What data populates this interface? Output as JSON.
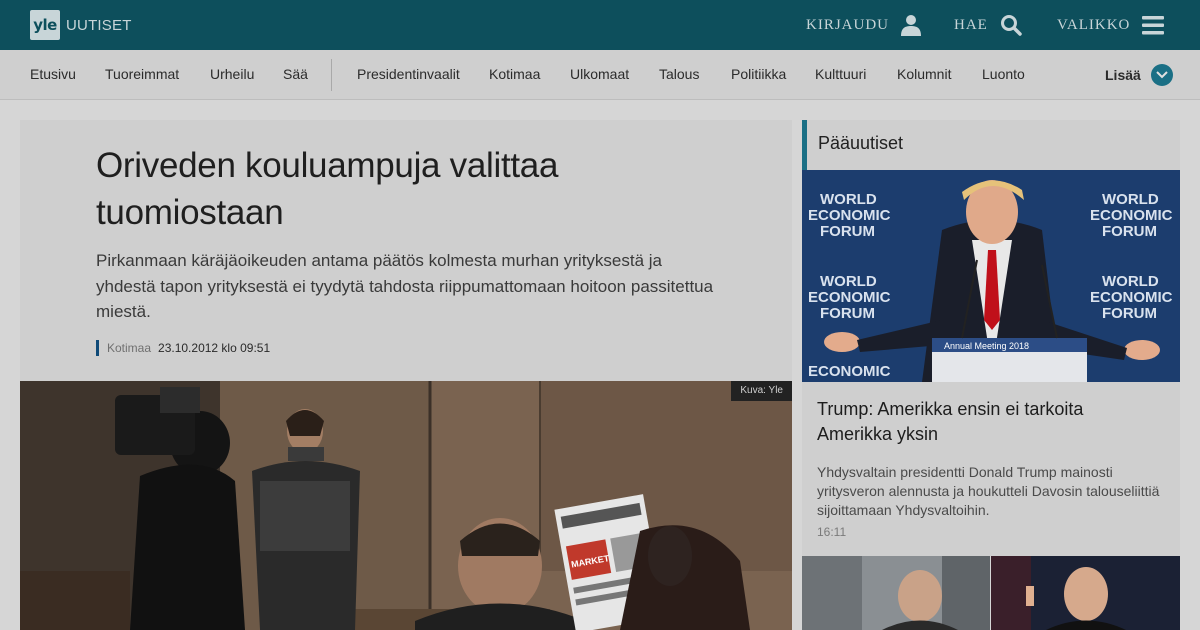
{
  "header": {
    "logo_mark": "yle",
    "logo_text": "UUTISET",
    "login_label": "KIRJAUDU",
    "search_label": "HAE",
    "menu_label": "VALIKKO",
    "icons": {
      "login": "user-icon",
      "search": "search-icon",
      "menu": "hamburger-menu-icon"
    }
  },
  "nav": {
    "items": [
      "Etusivu",
      "Tuoreimmat",
      "Urheilu",
      "Sää",
      "Presidentinvaalit",
      "Kotimaa",
      "Ulkomaat",
      "Talous",
      "Politiikka",
      "Kulttuuri",
      "Kolumnit",
      "Luonto"
    ],
    "more_label": "Lisää"
  },
  "article": {
    "title": "Oriveden kouluampuja valittaa tuomiostaan",
    "lead": "Pirkanmaan käräjäoikeuden antama päätös kolmesta murhan yrityksestä ja yhdestä tapon yrityksestä ei tyydytä tahdosta riippumattomaan hoitoon passitettua miestä.",
    "category": "Kotimaa",
    "date": "23.10.2012 klo 09:51",
    "image_credit": "Kuva: Yle",
    "newspaper_text": "MARKET"
  },
  "sidebar": {
    "title": "Pääuutiset",
    "story_headline": "Trump: Amerikka ensin ei tarkoita Amerikka yksin",
    "story_lead": "Yhdysvaltain presidentti Donald Trump mainosti yritysveron alennusta ja houkutteli Davosin talouseliittiä sijoittamaan Yhdysvaltoihin.",
    "story_time": "16:11",
    "photo_backdrop_text": [
      "WORLD",
      "ECONOMIC",
      "FORUM"
    ],
    "podium_text": "Annual Meeting 2018"
  },
  "colors": {
    "header_bg": "#0d4f5c",
    "nav_bg": "#cfcfcf",
    "accent": "#1a6f85",
    "page_bg": "#d6d6d6"
  }
}
